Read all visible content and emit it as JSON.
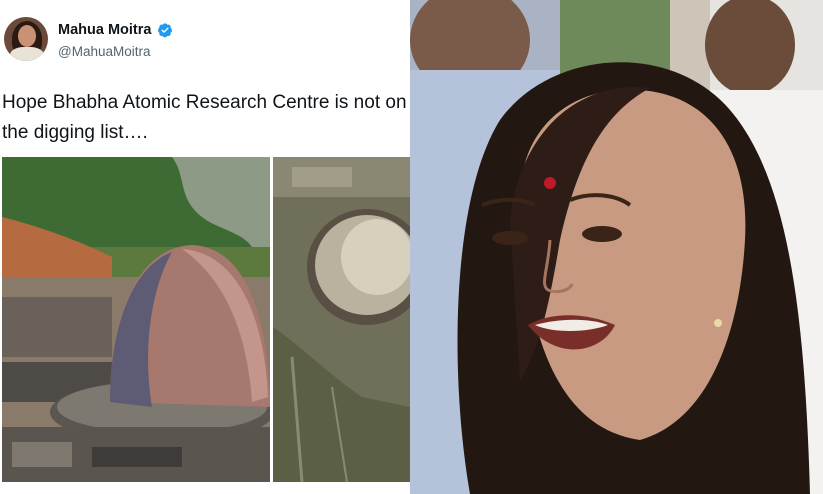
{
  "tweet": {
    "display_name": "Mahua Moitra",
    "handle": "@MahuaMoitra",
    "verified_icon": "verified-badge-icon",
    "text": "Hope Bhabha Atomic Research Centre is not on\nthe digging list….",
    "accent": "#1d9bf0"
  },
  "media": {
    "left_image": "reactor-dome-aerial-photo",
    "right_image": "reactor-dome-satellite-photo"
  },
  "right_photo": "speaker-portrait-photo"
}
